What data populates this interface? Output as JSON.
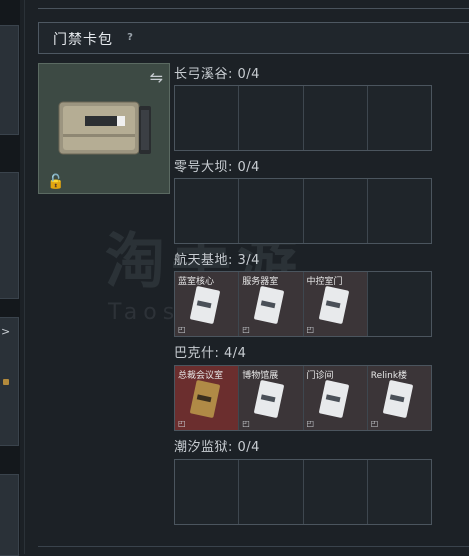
{
  "header": {
    "title": "门禁卡包",
    "help": "?"
  },
  "card_case": {
    "swap_icon": "swap-icon",
    "lock_icon": "lock-icon"
  },
  "sections": [
    {
      "name": "长弓溪谷: 0/4",
      "slots": [
        {
          "label": "",
          "state": "empty"
        },
        {
          "label": "",
          "state": "empty"
        },
        {
          "label": "",
          "state": "empty"
        },
        {
          "label": "",
          "state": "empty"
        }
      ]
    },
    {
      "name": "零号大坝: 0/4",
      "slots": [
        {
          "label": "",
          "state": "empty"
        },
        {
          "label": "",
          "state": "empty"
        },
        {
          "label": "",
          "state": "empty"
        },
        {
          "label": "",
          "state": "empty"
        }
      ]
    },
    {
      "name": "航天基地: 3/4",
      "slots": [
        {
          "label": "蓝室核心",
          "state": "filled"
        },
        {
          "label": "服务器室",
          "state": "filled"
        },
        {
          "label": "中控室门",
          "state": "filled"
        },
        {
          "label": "",
          "state": "empty"
        }
      ]
    },
    {
      "name": "巴克什: 4/4",
      "slots": [
        {
          "label": "总裁会议室",
          "state": "gold"
        },
        {
          "label": "博物馆展",
          "state": "filled"
        },
        {
          "label": "门诊间",
          "state": "filled"
        },
        {
          "label": "Relink楼",
          "state": "filled"
        }
      ]
    },
    {
      "name": "潮汐监狱: 0/4",
      "slots": [
        {
          "label": "",
          "state": "empty"
        },
        {
          "label": "",
          "state": "empty"
        },
        {
          "label": "",
          "state": "empty"
        },
        {
          "label": "",
          "state": "empty"
        }
      ]
    }
  ],
  "watermark": {
    "main": "淘手游",
    "sub": "Taoshouyou.com"
  },
  "colors": {
    "gold_slot": "#6b2e2e",
    "filled_slot": "#3b3538",
    "panel_bg": "#1c2126",
    "case_panel": "#3d4a44"
  }
}
